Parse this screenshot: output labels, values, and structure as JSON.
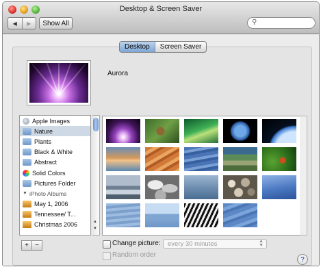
{
  "window": {
    "title": "Desktop & Screen Saver"
  },
  "toolbar": {
    "back_label": "◀",
    "forward_label": "▶",
    "show_all_label": "Show All",
    "search_value": ""
  },
  "tabs": [
    {
      "label": "Desktop",
      "active": true
    },
    {
      "label": "Screen Saver",
      "active": false
    }
  ],
  "current_picture": {
    "name": "Aurora"
  },
  "sidebar": {
    "items": [
      {
        "label": "Apple Images",
        "icon": "apple-icon"
      },
      {
        "label": "Nature",
        "icon": "folder-icon",
        "selected": true
      },
      {
        "label": "Plants",
        "icon": "folder-icon"
      },
      {
        "label": "Black & White",
        "icon": "folder-icon"
      },
      {
        "label": "Abstract",
        "icon": "folder-icon"
      },
      {
        "label": "Solid Colors",
        "icon": "color-wheel-icon"
      },
      {
        "label": "Pictures Folder",
        "icon": "folder-icon"
      }
    ],
    "section_label": "iPhoto Albums",
    "albums": [
      {
        "label": "May 1, 2006",
        "icon": "album-icon"
      },
      {
        "label": "Tennessee/ T...",
        "icon": "album-icon"
      },
      {
        "label": "Christmas 2006",
        "icon": "album-icon"
      }
    ],
    "add_label": "+",
    "remove_label": "−"
  },
  "options": {
    "change_picture_label": "Change picture:",
    "change_picture_checked": false,
    "interval_value": "every 30 minutes",
    "random_order_label": "Random order",
    "random_order_checked": false
  },
  "help_label": "?",
  "colors": {
    "selection_blue": "#7ea6d6",
    "sidebar_selected": "#cfd9e6"
  }
}
